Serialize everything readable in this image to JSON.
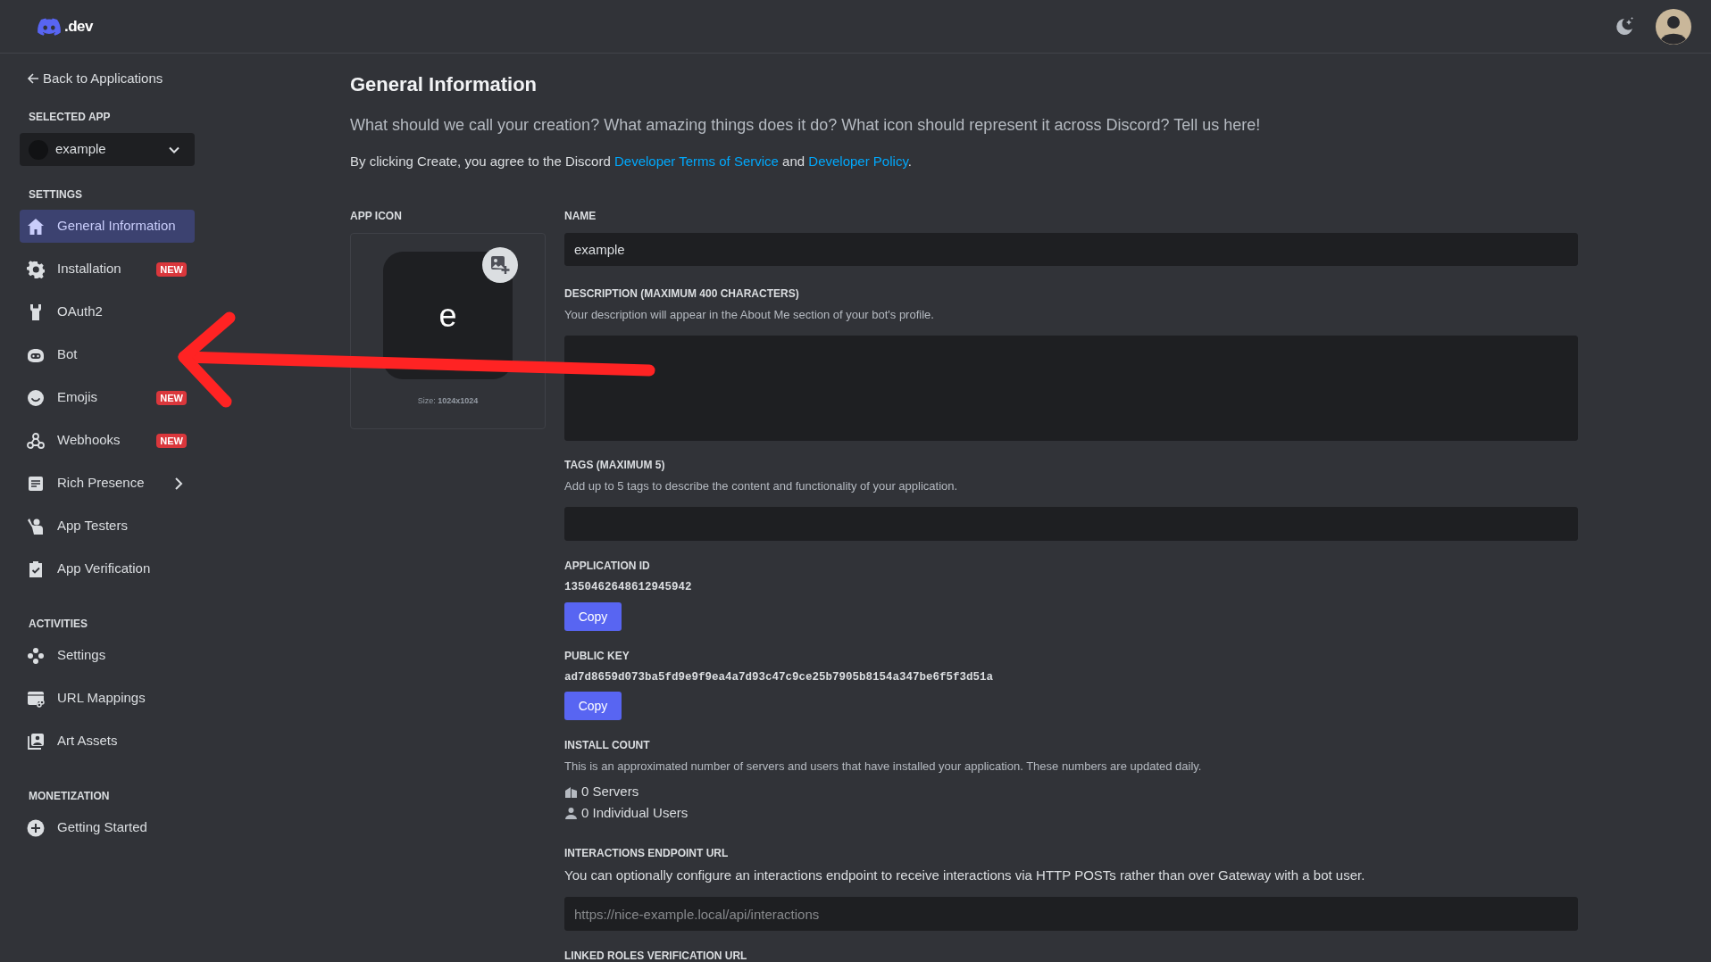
{
  "header": {
    "logo_text": ".dev"
  },
  "sidebar": {
    "back_link": "Back to Applications",
    "selected_app_label": "SELECTED APP",
    "selected_app": "example",
    "sections": [
      {
        "title": "SETTINGS",
        "items": [
          {
            "label": "General Information",
            "selected": true,
            "kind": "link"
          },
          {
            "label": "Installation",
            "selected": false,
            "kind": "link",
            "badge": "NEW"
          },
          {
            "label": "OAuth2",
            "selected": false,
            "kind": "link"
          },
          {
            "label": "Bot",
            "selected": false,
            "kind": "link"
          },
          {
            "label": "Emojis",
            "selected": false,
            "kind": "link",
            "badge": "NEW"
          },
          {
            "label": "Webhooks",
            "selected": false,
            "kind": "link",
            "badge": "NEW"
          },
          {
            "label": "Rich Presence",
            "selected": false,
            "kind": "group"
          },
          {
            "label": "App Testers",
            "selected": false,
            "kind": "link"
          },
          {
            "label": "App Verification",
            "selected": false,
            "kind": "link"
          }
        ]
      },
      {
        "title": "ACTIVITIES",
        "items": [
          {
            "label": "Settings",
            "selected": false,
            "kind": "link"
          },
          {
            "label": "URL Mappings",
            "selected": false,
            "kind": "link"
          },
          {
            "label": "Art Assets",
            "selected": false,
            "kind": "link"
          }
        ]
      },
      {
        "title": "MONETIZATION",
        "items": [
          {
            "label": "Getting Started",
            "selected": false,
            "kind": "link"
          }
        ]
      }
    ]
  },
  "main": {
    "title": "General Information",
    "intro": "What should we call your creation? What amazing things does it do? What icon should represent it across Discord? Tell us here!",
    "terms": [
      {
        "kind": "text",
        "text": "By clicking Create, you agree to the Discord "
      },
      {
        "kind": "link",
        "text": "Developer Terms of Service"
      },
      {
        "kind": "text",
        "text": " and "
      },
      {
        "kind": "link",
        "text": "Developer Policy"
      },
      {
        "kind": "text",
        "text": "."
      }
    ],
    "app_icon": {
      "label": "APP ICON",
      "letter": "e",
      "size_text": "Size: **1024x1024**"
    },
    "name": {
      "label": "NAME",
      "value": "example"
    },
    "description": {
      "label": "DESCRIPTION (MAXIMUM 400 CHARACTERS)",
      "help": "Your description will appear in the About Me section of your bot's profile."
    },
    "tags": {
      "label": "TAGS (MAXIMUM 5)",
      "help": "Add up to 5 tags to describe the content and functionality of your application."
    },
    "application_id": {
      "label": "APPLICATION ID",
      "value": "1350462648612945942",
      "button": "Copy"
    },
    "public_key": {
      "label": "PUBLIC KEY",
      "value": "ad7d8659d073ba5fd9e9f9ea4a7d93c47c9ce25b7905b8154a347be6f5f3d51a",
      "button": "Copy"
    },
    "install_count": {
      "label": "INSTALL COUNT",
      "help": "This is an approximated number of servers and users that have installed your application. These numbers are updated daily.",
      "stats": [
        "0 Servers",
        "0 Individual Users"
      ]
    },
    "interactions": {
      "label": "INTERACTIONS ENDPOINT URL",
      "help": "You can optionally configure an interactions endpoint to receive interactions via HTTP POSTs rather than over Gateway with a bot user.",
      "placeholder": "https://nice-example.local/api/interactions"
    },
    "linked_roles": {
      "label": "LINKED ROLES VERIFICATION URL"
    }
  }
}
